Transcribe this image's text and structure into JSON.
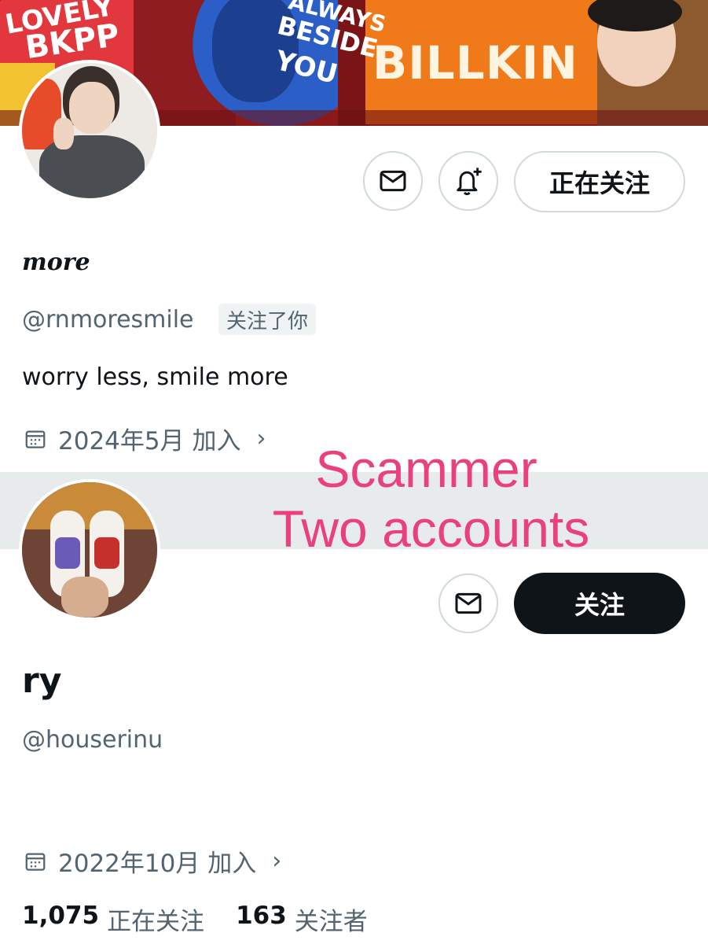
{
  "banner": {
    "sign_left_line1": "LOVELY",
    "sign_left_line2": "BKPP",
    "sign_mid_line1": "ALWAYS",
    "sign_mid_line2": "BESIDE",
    "sign_mid_line3": "YOU",
    "sign_right": "BILLKIN"
  },
  "profile1": {
    "display_name": "more",
    "handle": "@rnmoresmile",
    "follows_you_badge": "关注了你",
    "bio": "worry less, smile more",
    "joined": "2024年5月 加入",
    "following_button": "正在关注",
    "icons": {
      "message": "envelope-icon",
      "notify": "bell-plus-icon",
      "calendar": "calendar-icon"
    }
  },
  "overlay": {
    "line1": "Scammer",
    "line2": "Two accounts",
    "color": "#e8417d"
  },
  "profile2": {
    "display_name": "ry",
    "handle": "@houserinu",
    "joined": "2022年10月 加入",
    "follow_button": "关注",
    "stats": [
      {
        "number": "1,075",
        "label": "正在关注"
      },
      {
        "number": "163",
        "label": "关注者"
      }
    ]
  },
  "colors": {
    "text_primary": "#0f1419",
    "text_secondary": "#536471",
    "border": "#cfd9de",
    "dark_button": "#0f1419"
  }
}
